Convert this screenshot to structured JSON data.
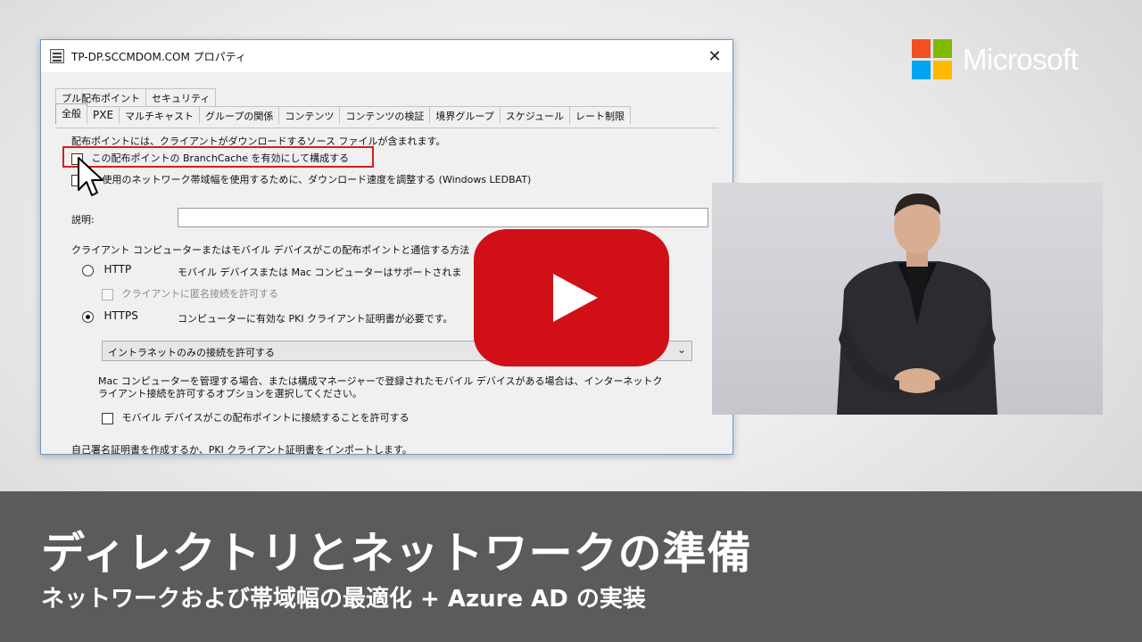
{
  "dialog": {
    "title": "TP-DP.SCCMDOM.COM プロパティ",
    "close_glyph": "✕",
    "tabs_back": [
      "プル配布ポイント",
      "セキュリティ"
    ],
    "tabs_front": [
      "全般",
      "PXE",
      "マルチキャスト",
      "グループの関係",
      "コンテンツ",
      "コンテンツの検証",
      "境界グループ",
      "スケジュール",
      "レート制限"
    ],
    "active_tab": "全般",
    "intro_text": "配布ポイントには、クライアントがダウンロードするソース ファイルが含まれます。",
    "branchcache_label": "この配布ポイントの BranchCache を有効にして構成する",
    "ledbat_label": "使用のネットワーク帯域幅を使用するために、ダウンロード速度を調整する (Windows LEDBAT)",
    "description_label": "説明:",
    "description_value": "",
    "comm_method_text": "クライアント コンピューターまたはモバイル デバイスがこの配布ポイントと通信する方法",
    "http_label": "HTTP",
    "http_desc": "モバイル デバイスまたは Mac コンピューターはサポートされま",
    "anon_label": "クライアントに匿名接続を許可する",
    "https_label": "HTTPS",
    "https_desc": "コンピューターに有効な PKI クライアント証明書が必要です。",
    "https_selected": true,
    "connection_select_value": "イントラネットのみの接続を許可する",
    "mac_note_line1": "Mac コンピューターを管理する場合、または構成マネージャーで登録されたモバイル デバイスがある場合は、インターネットク",
    "mac_note_line2": "ライアント接続を許可するオプションを選択してください。",
    "mobile_label": "モバイル デバイスがこの配布ポイントに接続することを許可する",
    "cert_text": "自己署名証明書を作成するか、PKI クライアント証明書をインポートします。"
  },
  "video": {
    "play_icon": "play-icon"
  },
  "brand": {
    "name": "Microsoft",
    "colors": [
      "#f25022",
      "#7fba00",
      "#00a4ef",
      "#ffb900"
    ]
  },
  "banner": {
    "title": "ディレクトリとネットワークの準備",
    "subtitle": "ネットワークおよび帯域幅の最適化 + Azure AD の実装"
  },
  "colors": {
    "play_red": "#d01016",
    "highlight_red": "#d81e1e",
    "banner_gray": "#5b5b5b"
  }
}
